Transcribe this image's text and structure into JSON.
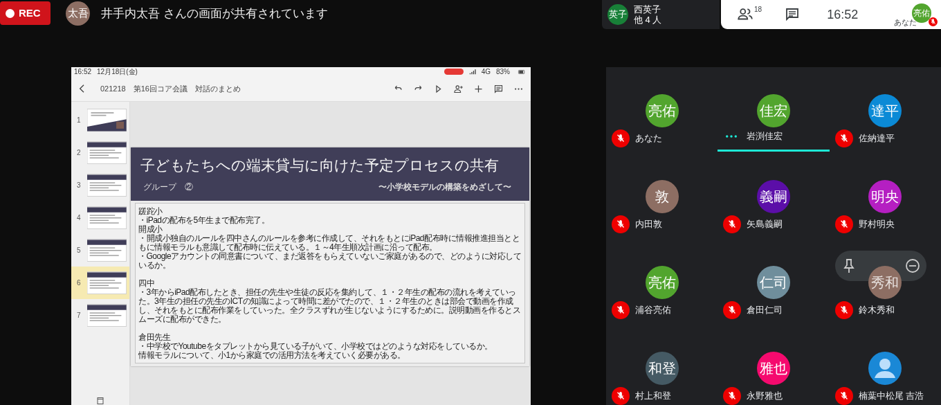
{
  "top_bar": {
    "rec_label": "REC",
    "presenter_initials": "太吾",
    "sharing_message": "井手内太吾 さんの画面が共有されています"
  },
  "others_badge": {
    "initials": "英子",
    "name": "西英子",
    "others": "他 4 人"
  },
  "meeting_controls": {
    "participant_count": "18",
    "time": "16:52",
    "self_initials": "亮佑",
    "self_label": "あなた",
    "self_muted": true
  },
  "tablet": {
    "status_time": "16:52",
    "status_date": "12月18日(金)",
    "network": "4G",
    "battery": "83%",
    "doc_title": "021218　第16回コア会議　対話のまとめ",
    "thumbnails": [
      {
        "number": "1",
        "kind": "title",
        "selected": false
      },
      {
        "number": "2",
        "kind": "content",
        "selected": false
      },
      {
        "number": "3",
        "kind": "content",
        "selected": false
      },
      {
        "number": "4",
        "kind": "content",
        "selected": false
      },
      {
        "number": "5",
        "kind": "content",
        "selected": false
      },
      {
        "number": "6",
        "kind": "content",
        "selected": true
      },
      {
        "number": "7",
        "kind": "content",
        "selected": false
      }
    ],
    "slide": {
      "title": "子どもたちへの端末貸与に向けた予定プロセスの共有",
      "subtitle": "グループ　②",
      "tagline": "〜小学校モデルの構築をめざして〜",
      "blocks": [
        [
          [
            "蹉跎小"
          ],
          [
            "・iPadの配布を5年生まで配布完了。"
          ],
          [
            "開成小"
          ],
          [
            "・開成小独自のルールを四中さんのルールを参考に作成して、それをもとにiPad配布時に情報推進担当とと",
            "もに情報モラルも意識して配布時に伝えている。１～4年生順次計画に沿って配布。"
          ],
          [
            "・Googleアカウントの同意書について、まだ返答をもらえていないご家庭があるので、どのように対応して",
            "いるか。"
          ]
        ],
        [
          [
            "四中"
          ],
          [
            "・3年からiPad配布したとき、担任の先生や生徒の反応を集約して、１・２年生の配布の流れを考えていっ",
            "た。3年生の担任の先生のICTの知識によって時間に差がでたので、１・２年生のときは部会で動画を作成",
            "し、それをもとに配布作業をしていった。全クラスずれが生じないようにするために。説明動画を作るとス",
            "ムーズに配布ができた。"
          ]
        ],
        [
          [
            "倉田先生"
          ],
          [
            "・中学校でYoutubeをタブレットから見ている子がいて、小学校ではどのような対応をしているか。",
            "情報モラルについて、小1から家庭での活用方法を考えていく必要がある。"
          ]
        ]
      ]
    }
  },
  "participants": [
    {
      "kind": "initials",
      "initials": "亮佑",
      "name": "あなた",
      "color": "#52a52e",
      "muted": true,
      "speaking": false,
      "hovered": false
    },
    {
      "kind": "initials",
      "initials": "佳宏",
      "name": "岩渕佳宏",
      "color": "#52a52e",
      "muted": false,
      "speaking": true,
      "hovered": false
    },
    {
      "kind": "initials",
      "initials": "達平",
      "name": "佐納達平",
      "color": "#0b8ad6",
      "muted": true,
      "speaking": false,
      "hovered": false
    },
    {
      "kind": "initials",
      "initials": "敦",
      "name": "内田敦",
      "color": "#8d6e63",
      "muted": true,
      "speaking": false,
      "hovered": false
    },
    {
      "kind": "initials",
      "initials": "義嗣",
      "name": "矢島義嗣",
      "color": "#5b0ea8",
      "muted": true,
      "speaking": false,
      "hovered": false
    },
    {
      "kind": "initials",
      "initials": "明央",
      "name": "野村明央",
      "color": "#b51fc2",
      "muted": true,
      "speaking": false,
      "hovered": false
    },
    {
      "kind": "initials",
      "initials": "亮佑",
      "name": "浦谷亮佑",
      "color": "#52a52e",
      "muted": true,
      "speaking": false,
      "hovered": false
    },
    {
      "kind": "initials",
      "initials": "仁司",
      "name": "倉田仁司",
      "color": "#6f8e9c",
      "muted": true,
      "speaking": false,
      "hovered": false
    },
    {
      "kind": "initials",
      "initials": "秀和",
      "name": "鈴木秀和",
      "color": "#8d6e63",
      "muted": true,
      "speaking": false,
      "hovered": true
    },
    {
      "kind": "initials",
      "initials": "和登",
      "name": "村上和登",
      "color": "#455a64",
      "muted": true,
      "speaking": false,
      "hovered": false
    },
    {
      "kind": "initials",
      "initials": "雅也",
      "name": "永野雅也",
      "color": "#f50a6e",
      "muted": true,
      "speaking": false,
      "hovered": false
    },
    {
      "kind": "person",
      "name": "楠葉中松尾 吉浩",
      "color": "#1a88d6",
      "muted": true,
      "speaking": false,
      "hovered": false
    }
  ]
}
